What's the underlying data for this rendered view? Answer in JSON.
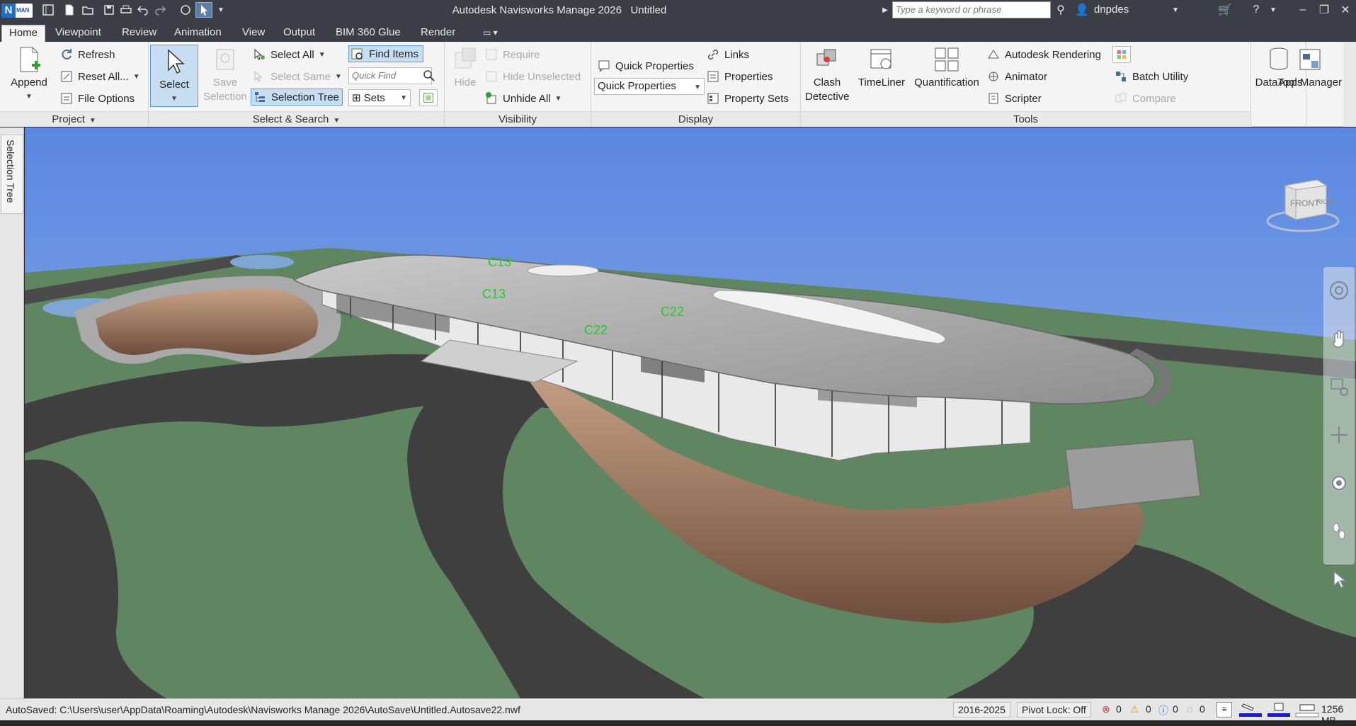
{
  "window": {
    "title": "Autodesk Navisworks Manage 2026",
    "document": "Untitled",
    "logo_letter": "N",
    "logo_text": "MAN",
    "search_placeholder": "Type a keyword or phrase",
    "user": "dnpdes"
  },
  "tabs": [
    "Home",
    "Viewpoint",
    "Review",
    "Animation",
    "View",
    "Output",
    "BIM 360 Glue",
    "Render"
  ],
  "ribbon": {
    "project": {
      "title": "Project",
      "append": "Append",
      "refresh": "Refresh",
      "reset_all": "Reset All...",
      "file_options": "File Options"
    },
    "select_search": {
      "title": "Select & Search",
      "select": "Select",
      "save_selection_1": "Save",
      "save_selection_2": "Selection",
      "select_all": "Select All",
      "select_same": "Select Same",
      "selection_tree": "Selection Tree",
      "find_items": "Find Items",
      "quick_find_placeholder": "Quick Find",
      "sets": "Sets"
    },
    "visibility": {
      "title": "Visibility",
      "hide": "Hide",
      "require": "Require",
      "hide_unselected": "Hide Unselected",
      "unhide_all": "Unhide All"
    },
    "display": {
      "title": "Display",
      "quick_properties": "Quick Properties",
      "quick_properties_combo": "Quick Properties",
      "links": "Links",
      "properties": "Properties",
      "property_sets": "Property Sets"
    },
    "tools": {
      "title": "Tools",
      "clash_1": "Clash",
      "clash_2": "Detective",
      "timeliner": "TimeLiner",
      "quantification": "Quantification",
      "autodesk_rendering": "Autodesk Rendering",
      "animator": "Animator",
      "scripter": "Scripter",
      "batch_utility": "Batch Utility",
      "compare": "Compare",
      "datatools": "DataTools",
      "app_manager": "App Manager"
    }
  },
  "side_tab": "Selection Tree",
  "viewport": {
    "annotations": [
      "C13",
      "C13",
      "C22",
      "C22"
    ],
    "viewcube_labels": [
      "FRONT",
      "RIGHT"
    ]
  },
  "status": {
    "autosaved": "AutoSaved: C:\\Users\\user\\AppData\\Roaming\\Autodesk\\Navisworks Manage 2026\\AutoSave\\Untitled.Autosave22.nwf",
    "years": "2016-2025",
    "pivot_lock": "Pivot Lock: Off",
    "errors": "0",
    "warnings": "0",
    "infos": "0",
    "messages": "0",
    "memory": "1256 MB"
  },
  "colors": {
    "titlebar": "#3b3f45",
    "ribbon": "#f4f4f4",
    "sky_top": "#5a88e0",
    "ground": "#5f8660",
    "annotation": "#22cc22"
  }
}
